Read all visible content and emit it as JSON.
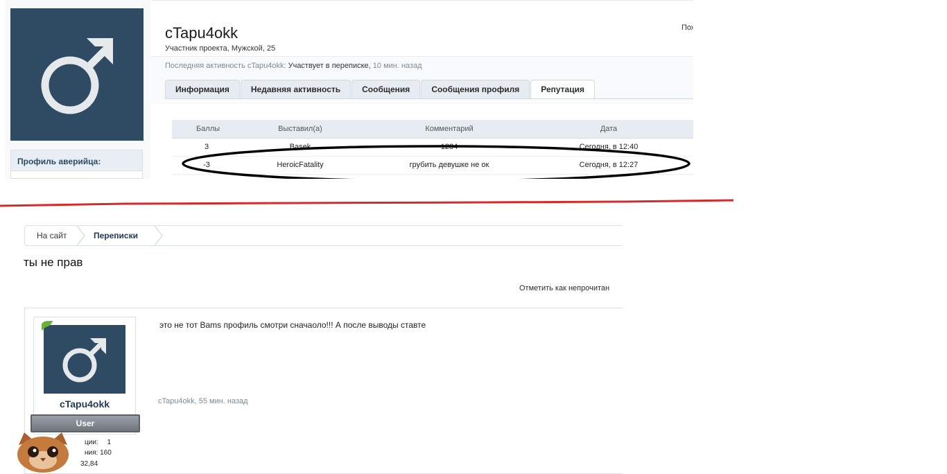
{
  "profile": {
    "username": "cTapu4okk",
    "subtitle": "Участник проекта, Мужской, 25",
    "last_activity_label": "Последняя активность cTapu4okk:",
    "last_activity_action": "Участвует в переписке,",
    "last_activity_time": "10 мин. назад",
    "position_label": "Пож",
    "sidebar_block_title": "Профиль аверийца:",
    "tabs": [
      {
        "label": "Информация"
      },
      {
        "label": "Недавняя активность"
      },
      {
        "label": "Сообщения"
      },
      {
        "label": "Сообщения профиля"
      },
      {
        "label": "Репутация"
      }
    ],
    "active_tab": "Репутация"
  },
  "reputation_table": {
    "columns": [
      "Баллы",
      "Выставил(а)",
      "Комментарий",
      "Дата"
    ],
    "rows": [
      {
        "points": "3",
        "by": "Basek",
        "comment": "1234",
        "date": "Сегодня, в 12:40"
      },
      {
        "points": "-3",
        "by": "HeroicFatality",
        "comment": "грубить девушке не ок",
        "date": "Сегодня, в 12:27"
      }
    ]
  },
  "conversation": {
    "breadcrumb": [
      "На сайт",
      "Переписки"
    ],
    "title": "ты не прав",
    "mark_unread_label": "Отметить как непрочитан",
    "post": {
      "author": "cTapu4okk",
      "role_banner": "User",
      "body": "это не тот Bams профиль смотри сначаоло!!! А после выводы ставте",
      "meta_author": "cTapu4okk,",
      "meta_time": "55 мин. назад",
      "stats": [
        {
          "label": "ции:",
          "value": "1"
        },
        {
          "label": "ния:",
          "value": "160"
        },
        {
          "label": "",
          "value": "32,84"
        }
      ]
    }
  },
  "colors": {
    "avatar_bg": "#2f4a63",
    "divider_red": "#d42a2a",
    "link_dark": "#1f3a56",
    "role_banner": "#7a8087"
  }
}
